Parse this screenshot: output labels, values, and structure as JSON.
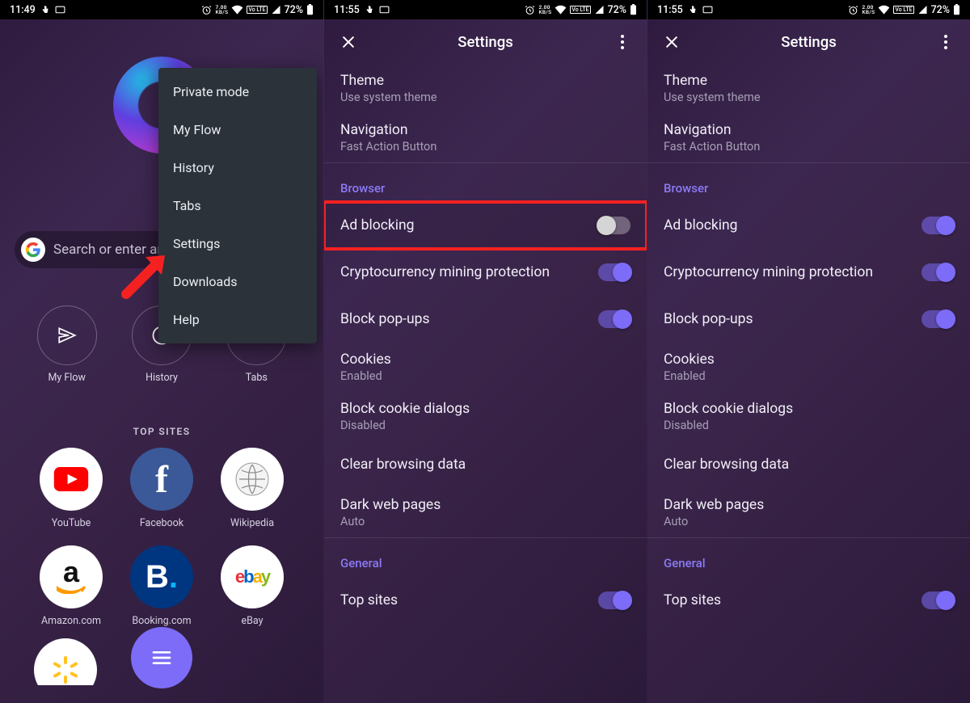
{
  "status": {
    "net_top": "2.00",
    "net_unit": "KB/S",
    "volte": "Vo LTE",
    "battery_pct": "72%"
  },
  "pane1": {
    "time": "11:49",
    "net_top": "7.00",
    "search_placeholder": "Search or enter an address",
    "circles": [
      {
        "label": "My Flow"
      },
      {
        "label": "History"
      },
      {
        "label": "Tabs"
      }
    ],
    "top_sites_heading": "TOP SITES",
    "sites": [
      {
        "id": "youtube",
        "label": "YouTube"
      },
      {
        "id": "facebook",
        "label": "Facebook"
      },
      {
        "id": "wikipedia",
        "label": "Wikipedia"
      },
      {
        "id": "amazon",
        "label": "Amazon.com"
      },
      {
        "id": "booking",
        "label": "Booking.com"
      },
      {
        "id": "ebay",
        "label": "eBay"
      }
    ],
    "menu": [
      "Private mode",
      "My Flow",
      "History",
      "Tabs",
      "Settings",
      "Downloads",
      "Help"
    ]
  },
  "pane2": {
    "time": "11:55",
    "title": "Settings",
    "theme_label": "Theme",
    "theme_sub": "Use system theme",
    "nav_label": "Navigation",
    "nav_sub": "Fast Action Button",
    "section_browser": "Browser",
    "adblock": "Ad blocking",
    "crypto": "Cryptocurrency mining protection",
    "popups": "Block pop-ups",
    "cookies_label": "Cookies",
    "cookies_sub": "Enabled",
    "cookied_label": "Block cookie dialogs",
    "cookied_sub": "Disabled",
    "cleardata": "Clear browsing data",
    "dark_label": "Dark web pages",
    "dark_sub": "Auto",
    "section_general": "General",
    "topsites": "Top sites"
  },
  "pane3": {
    "time": "11:55",
    "title": "Settings"
  }
}
